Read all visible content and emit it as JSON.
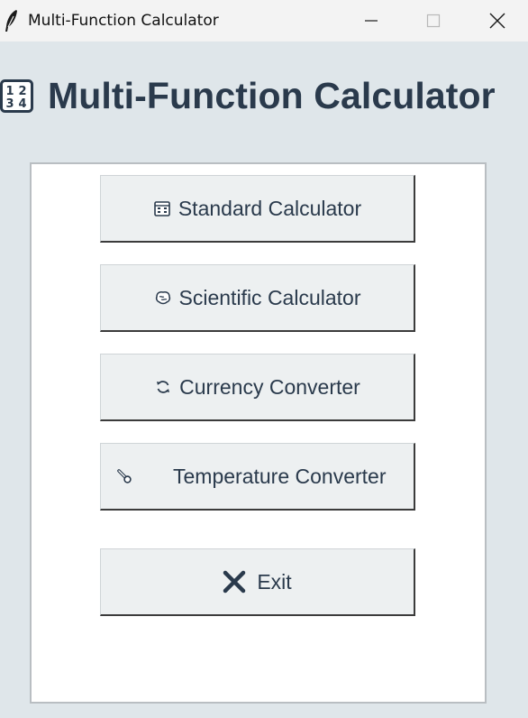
{
  "window": {
    "title": "Multi-Function Calculator",
    "controls": [
      "minimize",
      "maximize",
      "close"
    ]
  },
  "header": {
    "icon": "input-numbers-icon",
    "title": "Multi-Function Calculator"
  },
  "menu": {
    "buttons": [
      {
        "icon": "abacus-icon",
        "label": "Standard Calculator"
      },
      {
        "icon": "brain-icon",
        "label": "Scientific Calculator"
      },
      {
        "icon": "refresh-icon",
        "label": "Currency Converter"
      },
      {
        "icon": "thermometer-icon",
        "label": "Temperature Converter"
      },
      {
        "icon": "close-x-icon",
        "label": "Exit"
      }
    ]
  },
  "colors": {
    "background": "#dfe6ea",
    "titlebar": "#f3f3f3",
    "card": "#ffffff",
    "button": "#edf0f1",
    "text": "#2a3a4c"
  }
}
